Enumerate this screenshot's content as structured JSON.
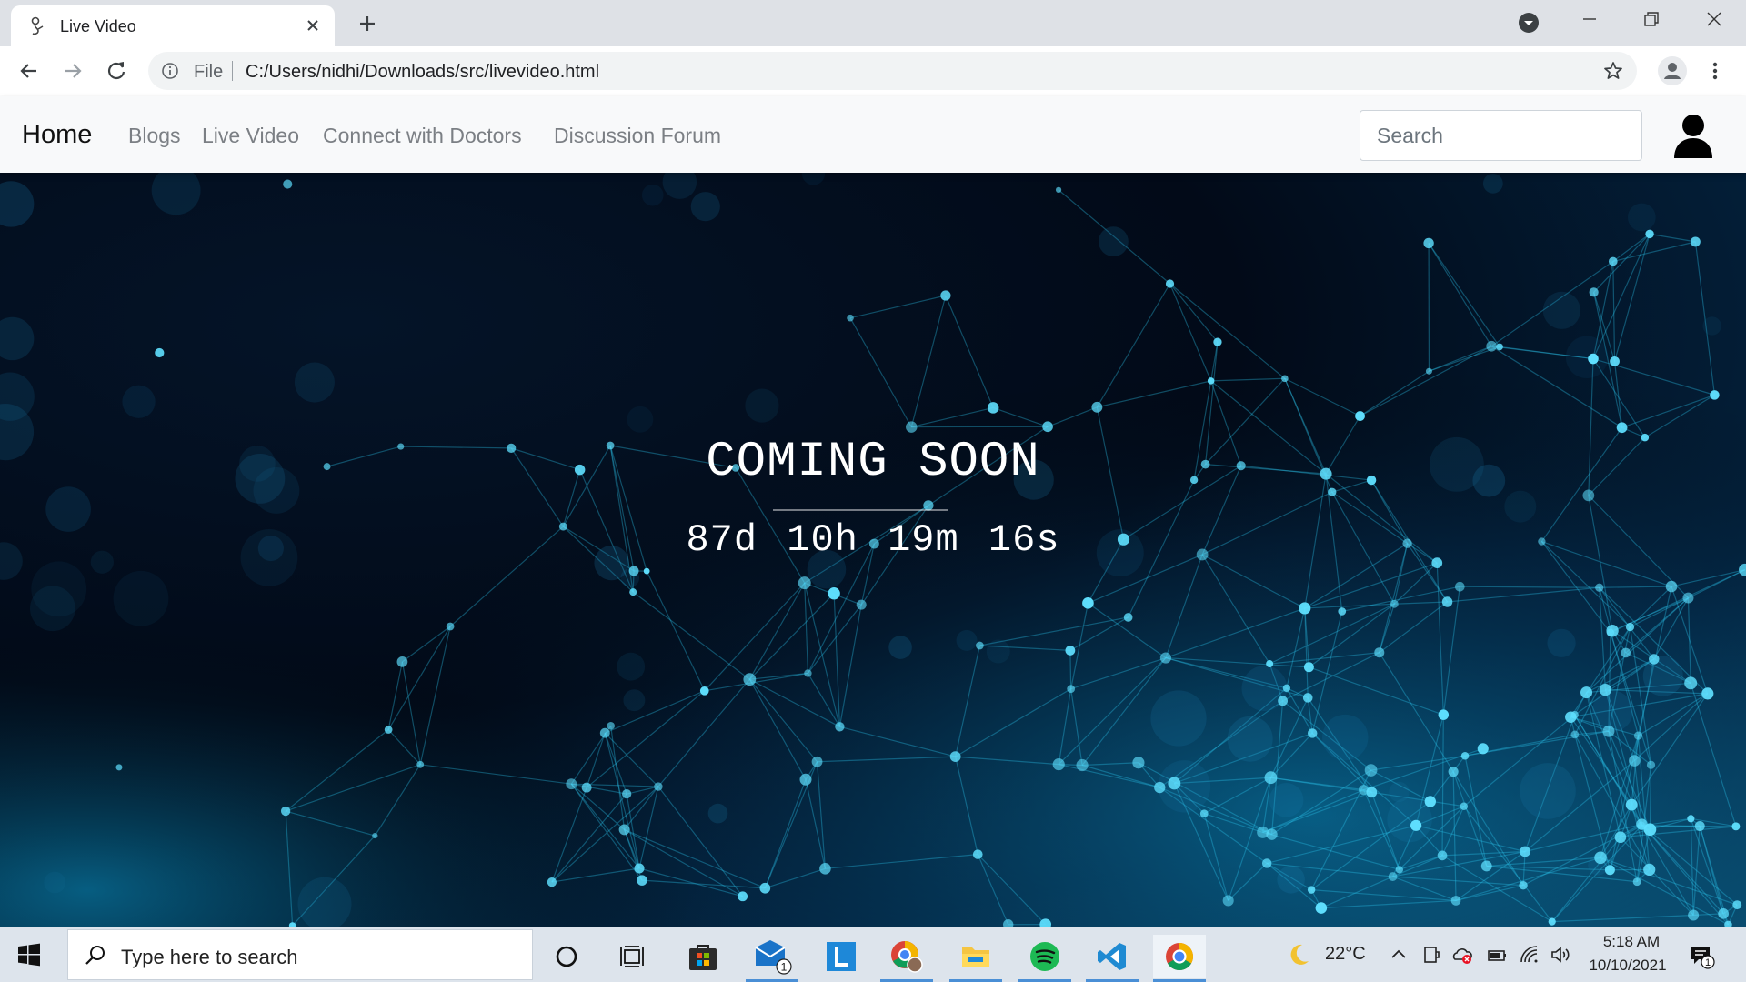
{
  "browser": {
    "tab": {
      "title": "Live Video"
    },
    "address": {
      "scheme_label": "File",
      "url": "C:/Users/nidhi/Downloads/src/livevideo.html"
    }
  },
  "navbar": {
    "brand": "Home",
    "links": [
      "Blogs",
      "Live Video",
      "Connect with Doctors",
      "Discussion Forum"
    ],
    "search_placeholder": "Search"
  },
  "hero": {
    "heading": "COMING SOON",
    "countdown": "87d 10h 19m 16s"
  },
  "taskbar": {
    "search_placeholder": "Type here to search",
    "apps": [
      "cortana-icon",
      "task-view-icon",
      "store-icon",
      "mail-icon",
      "lens-app-icon",
      "chrome-profile-icon",
      "file-explorer-icon",
      "spotify-icon",
      "vscode-icon",
      "chrome-icon"
    ],
    "mail_badge": "1",
    "weather": "22°C",
    "time": "5:18 AM",
    "date": "10/10/2021",
    "notification_badge": "1"
  },
  "colors": {
    "hero_bg": "#020a18",
    "network_glow": "#20c8f0",
    "navbar_bg": "#f8f9fa",
    "taskbar_bg": "#dde4ec"
  }
}
